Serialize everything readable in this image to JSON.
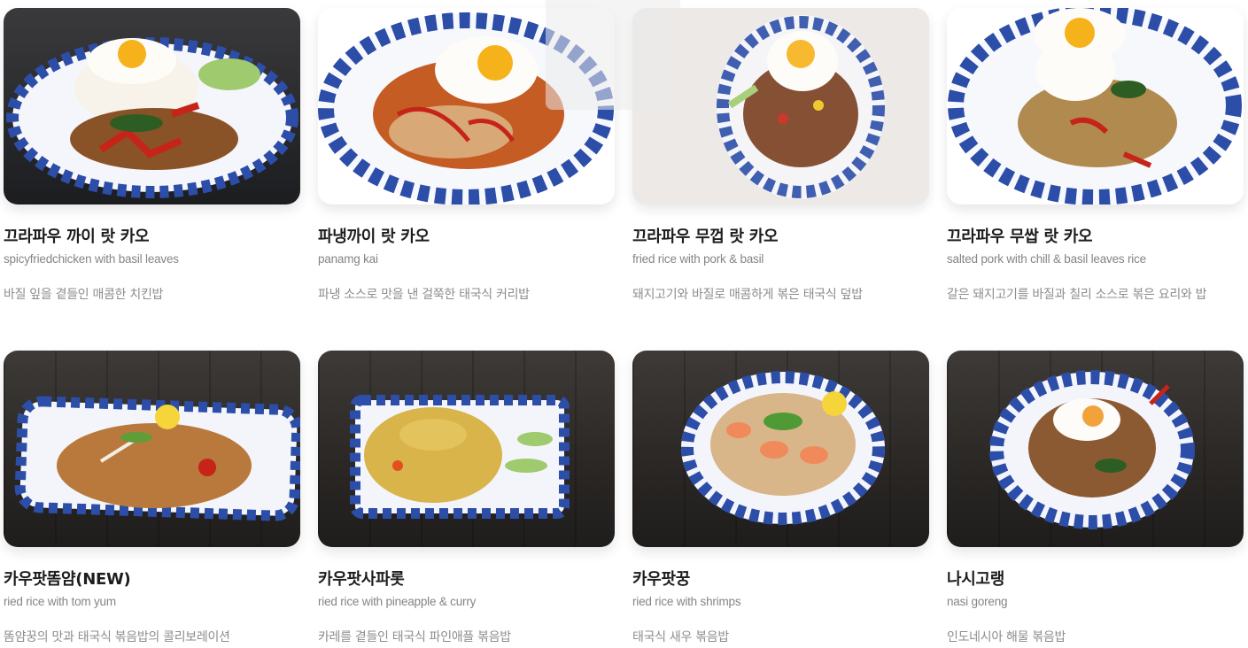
{
  "menu": {
    "items": [
      {
        "name": "끄라파우 까이 랏 카오",
        "subtitle": "spicyfriedchicken with basil leaves",
        "description": "바질 잎을 곁들인 매콤한 치킨밥",
        "image": "basil-chicken-rice-photo"
      },
      {
        "name": "파냉까이 랏 카오",
        "subtitle": "panamg kai",
        "description": "파냉 소스로 맛을 낸 걸쭉한 태국식 커리밥",
        "image": "panang-curry-rice-photo"
      },
      {
        "name": "끄라파우 무껍 랏 카오",
        "subtitle": "fried rice with pork & basil",
        "description": "돼지고기와 바질로 매콤하게 볶은 태국식 덮밥",
        "image": "crispy-pork-basil-rice-photo"
      },
      {
        "name": "끄라파우 무쌉 랏 카오",
        "subtitle": "salted pork with chill & basil leaves rice",
        "description": "갈은 돼지고기를 바질과 칠리 소스로 볶은 요리와 밥",
        "image": "minced-pork-basil-rice-photo"
      },
      {
        "name": "카우팟똠얌(NEW)",
        "subtitle": "ried rice with tom yum",
        "description": "똠얌꿍의 맛과 태국식 볶음밥의 콜리보레이션",
        "image": "tom-yum-fried-rice-photo"
      },
      {
        "name": "카우팟사파롯",
        "subtitle": "ried rice with pineapple & curry",
        "description": "카레를 곁들인 태국식 파인애플 볶음밥",
        "image": "pineapple-fried-rice-photo"
      },
      {
        "name": "카우팟꿍",
        "subtitle": "ried rice with shrimps",
        "description": "태국식 새우 볶음밥",
        "image": "shrimp-fried-rice-photo"
      },
      {
        "name": "나시고랭",
        "subtitle": "nasi goreng",
        "description": "인도네시아 해물 볶음밥",
        "image": "nasi-goreng-photo"
      }
    ]
  },
  "colors": {
    "plate_blue": "#2c4ea8",
    "name_text": "#1d1d1d",
    "subtitle_text": "#858585",
    "desc_text": "#8d8d8d"
  }
}
